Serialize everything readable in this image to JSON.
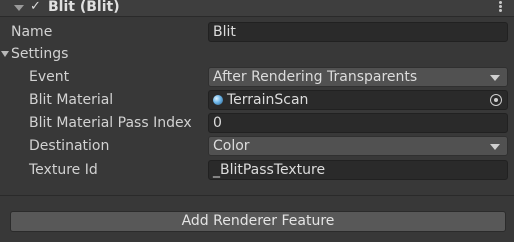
{
  "header": {
    "title": "Blit (Blit)",
    "enabled_icon": "check-icon",
    "menu_icon": "kebab-menu-icon"
  },
  "name": {
    "label": "Name",
    "value": "Blit"
  },
  "settings": {
    "label": "Settings",
    "event": {
      "label": "Event",
      "value": "After Rendering Transparents"
    },
    "material": {
      "label": "Blit Material",
      "value": "TerrainScan"
    },
    "pass_index": {
      "label": "Blit Material Pass Index",
      "value": "0"
    },
    "destination": {
      "label": "Destination",
      "value": "Color"
    },
    "texture_id": {
      "label": "Texture Id",
      "value": "_BlitPassTexture"
    }
  },
  "add_button": {
    "label": "Add Renderer Feature"
  }
}
